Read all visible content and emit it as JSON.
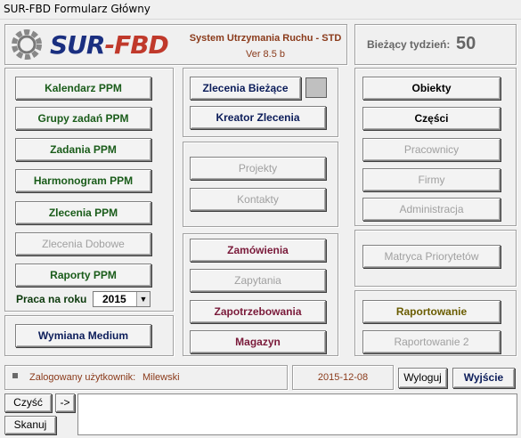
{
  "window": {
    "title": "SUR-FBD Formularz Główny"
  },
  "header": {
    "logo": "SUR-FBD",
    "system_name": "System Utrzymania Ruchu - STD",
    "version": "Ver 8.5 b",
    "week_label": "Bieżący tydzień:",
    "week_number": "50"
  },
  "left": {
    "kalendarz": "Kalendarz PPM",
    "grupy": "Grupy zadań PPM",
    "zadania": "Zadania PPM",
    "harmonogram": "Harmonogram PPM",
    "zlecenia": "Zlecenia PPM",
    "zlecenia_dobowe": "Zlecenia Dobowe",
    "raporty": "Raporty PPM",
    "praca_label": "Praca na roku",
    "praca_year": "2015",
    "wymiana": "Wymiana Medium"
  },
  "middle": {
    "zlecenia_biezace": "Zlecenia Bieżące",
    "kreator": "Kreator Zlecenia",
    "projekty": "Projekty",
    "kontakty": "Kontakty",
    "zamowienia": "Zamówienia",
    "zapytania": "Zapytania",
    "zapotrzebowania": "Zapotrzebowania",
    "magazyn": "Magazyn"
  },
  "right": {
    "obiekty": "Obiekty",
    "czesci": "Części",
    "pracownicy": "Pracownicy",
    "firmy": "Firmy",
    "administracja": "Administracja",
    "matryca": "Matryca Priorytetów",
    "raportowanie": "Raportowanie",
    "raportowanie2": "Raportowanie 2"
  },
  "status": {
    "user_label": "Zalogowany użytkownik:",
    "user_name": "Milewski",
    "date": "2015-12-08",
    "logout": "Wyloguj",
    "exit": "Wyjście"
  },
  "bottom": {
    "clear": "Czyść",
    "arrow": "->",
    "scan": "Skanuj"
  },
  "colors": {
    "green": "#1a5c1a",
    "navy": "#0c1d5a",
    "maroon": "#7a1a3a",
    "olive": "#6a5c00",
    "disabled": "#a0a0a0"
  }
}
